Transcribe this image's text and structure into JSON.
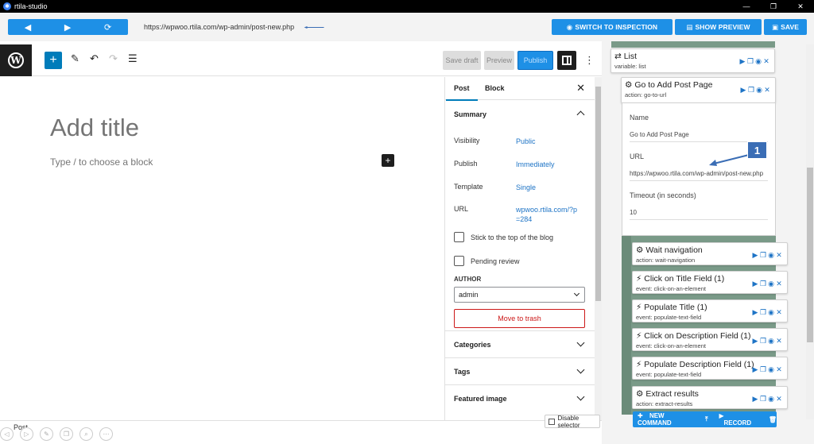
{
  "window": {
    "title": "rtila-studio",
    "controls": [
      "—",
      "❐",
      "✕"
    ]
  },
  "rtila": {
    "nav": {
      "back": "◀",
      "forward": "▶",
      "reload": "⟳"
    },
    "url": "https://wpwoo.rtila.com/wp-admin/post-new.php",
    "switch_label": "SWITCH TO INSPECTION",
    "preview_label": "SHOW PREVIEW",
    "save_label": "SAVE",
    "bottom": {
      "new_command": "NEW COMMAND",
      "record": "RECORD"
    }
  },
  "wp": {
    "toolbar": {
      "save_draft": "Save draft",
      "preview": "Preview",
      "publish": "Publish"
    },
    "editor": {
      "title_placeholder": "Add title",
      "block_hint": "Type / to choose a block"
    },
    "sidebar": {
      "tabs": [
        "Post",
        "Block"
      ],
      "summary": {
        "heading": "Summary",
        "rows": [
          {
            "label": "Visibility",
            "value": "Public"
          },
          {
            "label": "Publish",
            "value": "Immediately"
          },
          {
            "label": "Template",
            "value": "Single"
          },
          {
            "label": "URL",
            "value": "wpwoo.rtila.com/?p=284"
          }
        ],
        "checkboxes": [
          "Stick to the top of the blog",
          "Pending review"
        ],
        "author_label": "AUTHOR",
        "author_value": "admin",
        "trash_label": "Move to trash"
      },
      "panels": [
        "Categories",
        "Tags",
        "Featured image"
      ]
    },
    "status": {
      "breadcrumb": "Post",
      "disable_selector": "Disable selector"
    }
  },
  "commands": {
    "list": {
      "title": "List",
      "sub": "variable:  list"
    },
    "goto": {
      "title": "Go to Add Post Page",
      "sub": "action:  go-to-url",
      "fields": [
        {
          "label": "Name",
          "value": "Go to Add Post Page"
        },
        {
          "label": "URL",
          "value": "https://wpwoo.rtila.com/wp-admin/post-new.php"
        },
        {
          "label": "Timeout (in seconds)",
          "value": "10"
        }
      ]
    },
    "callout": "1",
    "steps": [
      {
        "icon": "gear",
        "title": "Wait navigation",
        "sub": "action:  wait-navigation"
      },
      {
        "icon": "bolt",
        "title": "Click on Title Field (1)",
        "sub": "event:  click-on-an-element"
      },
      {
        "icon": "bolt",
        "title": "Populate Title (1)",
        "sub": "event:  populate-text-field"
      },
      {
        "icon": "bolt",
        "title": "Click on Description Field (1)",
        "sub": "event:  click-on-an-element"
      },
      {
        "icon": "bolt",
        "title": "Populate Description Field (1)",
        "sub": "event:  populate-text-field"
      },
      {
        "icon": "gear",
        "title": "Extract results",
        "sub": "action:  extract-results"
      }
    ]
  },
  "colors": {
    "accent": "#1e90e6",
    "wp_blue": "#007cba",
    "stripe": "#7a9a88",
    "danger": "#cc1818"
  }
}
